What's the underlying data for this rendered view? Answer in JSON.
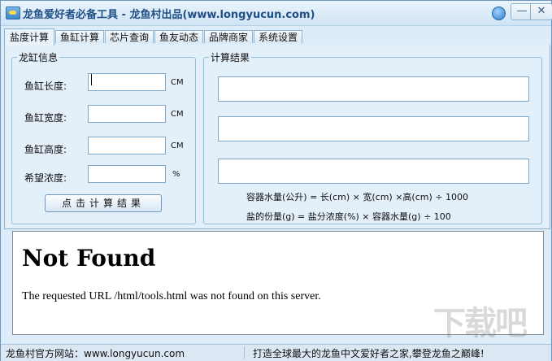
{
  "window": {
    "title": "龙鱼爱好者必备工具 - 龙鱼村出品(www.longyucun.com)",
    "minimize_glyph": "—",
    "close_glyph": "✕"
  },
  "icons": {
    "app": "fish-icon",
    "skin": "skin-icon"
  },
  "tabs": [
    {
      "label": "盐度计算",
      "active": true
    },
    {
      "label": "鱼缸计算",
      "active": false
    },
    {
      "label": "芯片查询",
      "active": false
    },
    {
      "label": "鱼友动态",
      "active": false
    },
    {
      "label": "品牌商家",
      "active": false
    },
    {
      "label": "系统设置",
      "active": false
    }
  ],
  "tank_info": {
    "title": "龙缸信息",
    "fields": [
      {
        "label": "鱼缸长度:",
        "value": "",
        "unit": "CM"
      },
      {
        "label": "鱼缸宽度:",
        "value": "",
        "unit": "CM"
      },
      {
        "label": "鱼缸高度:",
        "value": "",
        "unit": "CM"
      },
      {
        "label": "希望浓度:",
        "value": "",
        "unit": "%"
      }
    ],
    "calc_button": "点击计算结果"
  },
  "results": {
    "title": "计算结果",
    "boxes": [
      "",
      "",
      ""
    ],
    "formula_water": "容器水量(公升) = 长(cm) × 宽(cm) ×高(cm) ÷ 1000",
    "formula_salt": "盐的份量(g) = 盐分浓度(%) × 容器水量(g) ÷ 100"
  },
  "webview": {
    "heading": "Not Found",
    "message": "The requested URL /html/tools.html was not found on this server."
  },
  "status": {
    "left": "龙鱼村官方网站：www.longyucun.com",
    "right": "打造全球最大的龙鱼中文爱好者之家,攀登龙鱼之巅峰!"
  },
  "watermark": "下载吧",
  "colors": {
    "accent": "#1f4f86",
    "panel": "#e3eff9",
    "border": "#8fb3d3"
  }
}
